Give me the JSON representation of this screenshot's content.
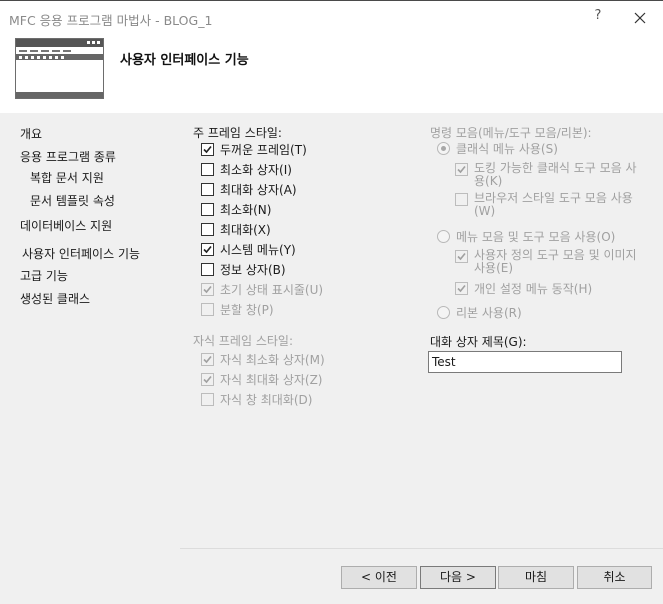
{
  "window": {
    "title": "MFC 응용 프로그램 마법사 - BLOG_1",
    "help_label": "?",
    "header_title": "사용자 인터페이스 기능"
  },
  "icons": {
    "header": "window-frame-icon",
    "close": "close-icon",
    "check": "checkmark-icon"
  },
  "sidebar": {
    "items": [
      {
        "label": "개요"
      },
      {
        "label": "응용 프로그램 종류"
      },
      {
        "label": "복합 문서 지원"
      },
      {
        "label": "문서 템플릿 속성"
      },
      {
        "label": "데이터베이스 지원"
      },
      {
        "label": "사용자 인터페이스 기능",
        "selected": true
      },
      {
        "label": "고급 기능"
      },
      {
        "label": "생성된 클래스"
      }
    ]
  },
  "main_frame": {
    "label": "주 프레임 스타일:",
    "options": [
      {
        "label": "두꺼운 프레임(T)",
        "checked": true,
        "enabled": true
      },
      {
        "label": "최소화 상자(I)",
        "checked": false,
        "enabled": true
      },
      {
        "label": "최대화 상자(A)",
        "checked": false,
        "enabled": true
      },
      {
        "label": "최소화(N)",
        "checked": false,
        "enabled": true
      },
      {
        "label": "최대화(X)",
        "checked": false,
        "enabled": true
      },
      {
        "label": "시스템 메뉴(Y)",
        "checked": true,
        "enabled": true
      },
      {
        "label": "정보 상자(B)",
        "checked": false,
        "enabled": true
      },
      {
        "label": "초기 상태 표시줄(U)",
        "checked": true,
        "enabled": false
      },
      {
        "label": "분할 창(P)",
        "checked": false,
        "enabled": false
      }
    ]
  },
  "child_frame": {
    "label": "자식 프레임 스타일:",
    "options": [
      {
        "label": "자식 최소화 상자(M)",
        "checked": true,
        "enabled": false
      },
      {
        "label": "자식 최대화 상자(Z)",
        "checked": true,
        "enabled": false
      },
      {
        "label": "자식 창 최대화(D)",
        "checked": false,
        "enabled": false
      }
    ]
  },
  "command_bars": {
    "label": "명령 모음(메뉴/도구 모음/리본):",
    "classic": {
      "label": "클래식 메뉴 사용(S)",
      "selected": true
    },
    "classic_sub": [
      {
        "line1": "도킹 가능한 클래식 도구 모음 사",
        "line2": "용(K)",
        "checked": true
      },
      {
        "line1": "브라우저 스타일 도구 모음 사용",
        "line2": "(W)",
        "checked": false
      }
    ],
    "menus": {
      "label": "메뉴 모음 및 도구 모음 사용(O)",
      "selected": false
    },
    "menus_sub": [
      {
        "line1": "사용자 정의 도구 모음 및 이미지",
        "line2": "사용(E)",
        "checked": true
      },
      {
        "line1": "개인 설정 메뉴 동작(H)",
        "line2": "",
        "checked": true
      }
    ],
    "ribbon": {
      "label": "리본 사용(R)",
      "selected": false
    }
  },
  "dialog_title": {
    "label": "대화 상자 제목(G):",
    "value": "Test"
  },
  "buttons": {
    "prev": "< 이전",
    "next": "다음 >",
    "finish": "마침",
    "cancel": "취소"
  }
}
